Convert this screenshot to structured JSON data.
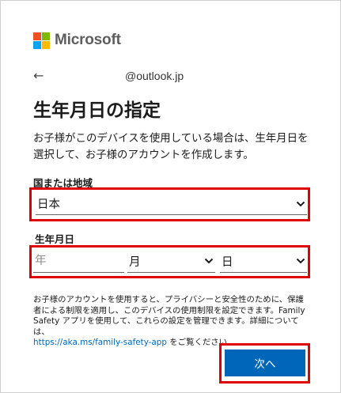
{
  "brand": {
    "name": "Microsoft"
  },
  "identity": {
    "back_label": "←",
    "account": "@outlook.jp"
  },
  "title": "生年月日の指定",
  "description": "お子様がこのデバイスを使用している場合は、生年月日を選択して、お子様のアカウントを作成します。",
  "country": {
    "label": "国または地域",
    "value": "日本"
  },
  "dob": {
    "label": "生年月日",
    "year_placeholder": "年",
    "month_value": "月",
    "day_value": "日"
  },
  "privacy": {
    "text": "お子様のアカウントを使用すると、プライバシーと安全性のために、保護者による制限を適用し、このデバイスの使用制限を設定できます。Family Safety アプリを使用して、これらの設定を管理できます。詳細については、",
    "link": "https://aka.ms/family-safety-app",
    "suffix": " をご覧ください"
  },
  "next_button": "次へ",
  "colors": {
    "accent": "#0067b8",
    "highlight": "#e00000",
    "logo_red": "#f25022",
    "logo_green": "#7fba00",
    "logo_blue": "#00a4ef",
    "logo_yellow": "#ffb900"
  }
}
